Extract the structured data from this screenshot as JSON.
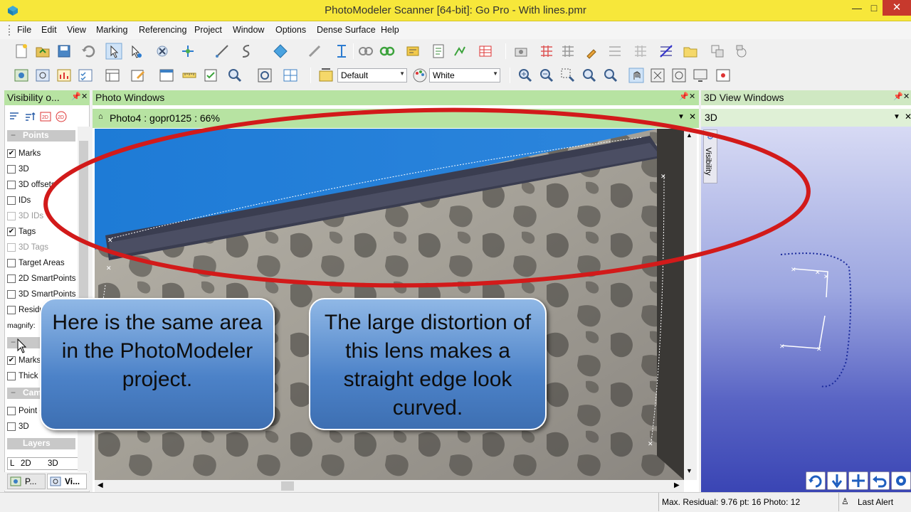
{
  "window": {
    "title": "PhotoModeler Scanner [64-bit]: Go Pro - With lines.pmr",
    "minimize": "—",
    "maximize": "□",
    "close": "✕"
  },
  "menu": [
    "File",
    "Edit",
    "View",
    "Marking",
    "Referencing",
    "Project",
    "Window",
    "Options",
    "Dense Surface",
    "Help"
  ],
  "toolbar2": {
    "style_combo": "Default",
    "color_combo": "White"
  },
  "visibility_panel": {
    "title": "Visibility o...",
    "groups": {
      "points": "Points",
      "lines": "Lines",
      "cameras": "Cam",
      "layers": "Layers"
    },
    "point_options": [
      {
        "label": "Marks",
        "checked": true,
        "enabled": true
      },
      {
        "label": "3D",
        "checked": false,
        "enabled": true
      },
      {
        "label": "3D offsets",
        "checked": false,
        "enabled": true
      },
      {
        "label": "IDs",
        "checked": false,
        "enabled": true
      },
      {
        "label": "3D IDs",
        "checked": false,
        "enabled": false
      },
      {
        "label": "Tags",
        "checked": true,
        "enabled": true
      },
      {
        "label": "3D Tags",
        "checked": false,
        "enabled": false
      },
      {
        "label": "Target Areas",
        "checked": false,
        "enabled": true
      },
      {
        "label": "2D SmartPoints",
        "checked": false,
        "enabled": true
      },
      {
        "label": "3D SmartPoints",
        "checked": false,
        "enabled": true
      },
      {
        "label": "Residu",
        "checked": false,
        "enabled": true
      }
    ],
    "magnify_label": "magnify:",
    "line_options": [
      {
        "label": "Marks",
        "checked": true
      },
      {
        "label": "Thick",
        "checked": false
      }
    ],
    "camera_options": [
      {
        "label": "Point c",
        "checked": false
      },
      {
        "label": "3D",
        "checked": false
      }
    ],
    "layers_columns": [
      "L",
      "2D",
      "3D"
    ]
  },
  "bottom_tabs": [
    {
      "label": "P..."
    },
    {
      "label": "Vi..."
    }
  ],
  "photo_windows": {
    "title": "Photo Windows",
    "sub_title": "Photo4 : gopr0125 : 66%"
  },
  "view3d_windows": {
    "title": "3D View Windows",
    "sub_title": "3D",
    "side_tab": "Visibility"
  },
  "callouts": {
    "left": "Here is the same area in the PhotoModeler project.",
    "right": "The large distortion of this lens makes a straight edge look curved."
  },
  "status": {
    "residual": "Max. Residual: 9.76 pt: 16 Photo: 12",
    "alert": "Last Alert"
  },
  "colors": {
    "titlebar": "#f7e73a",
    "panel_header": "#b7e3a2",
    "annotation_ellipse": "#d21a1a",
    "callout_blue": "#4c82c8"
  }
}
